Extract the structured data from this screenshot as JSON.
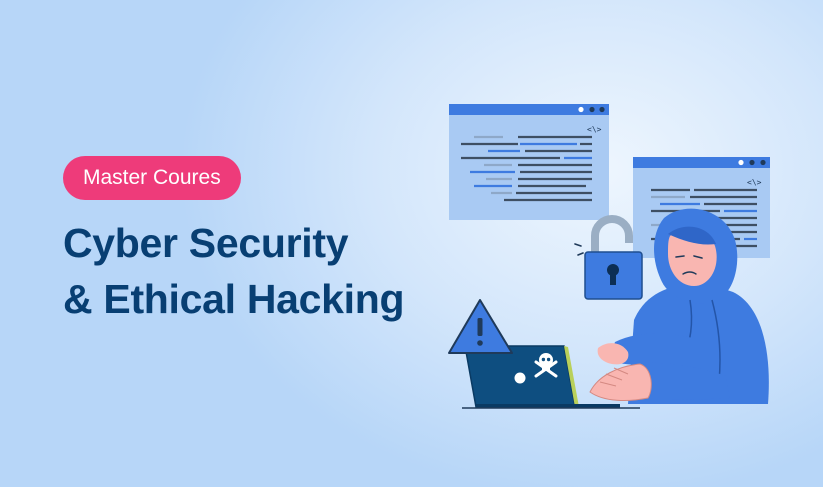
{
  "badge": {
    "label": "Master Coures"
  },
  "headline": {
    "line1": "Cyber Security",
    "line2": "& Ethical Hacking"
  },
  "colors": {
    "badge_bg": "#ee3b7a",
    "headline": "#083f73",
    "accent_blue": "#3e7be0",
    "background": "#cfe3fb"
  },
  "illustration": {
    "code_window_tag": "<\\>",
    "icons": [
      "code-window",
      "padlock-open",
      "warning-triangle",
      "laptop",
      "skull-crossbones",
      "hooded-hacker"
    ]
  }
}
